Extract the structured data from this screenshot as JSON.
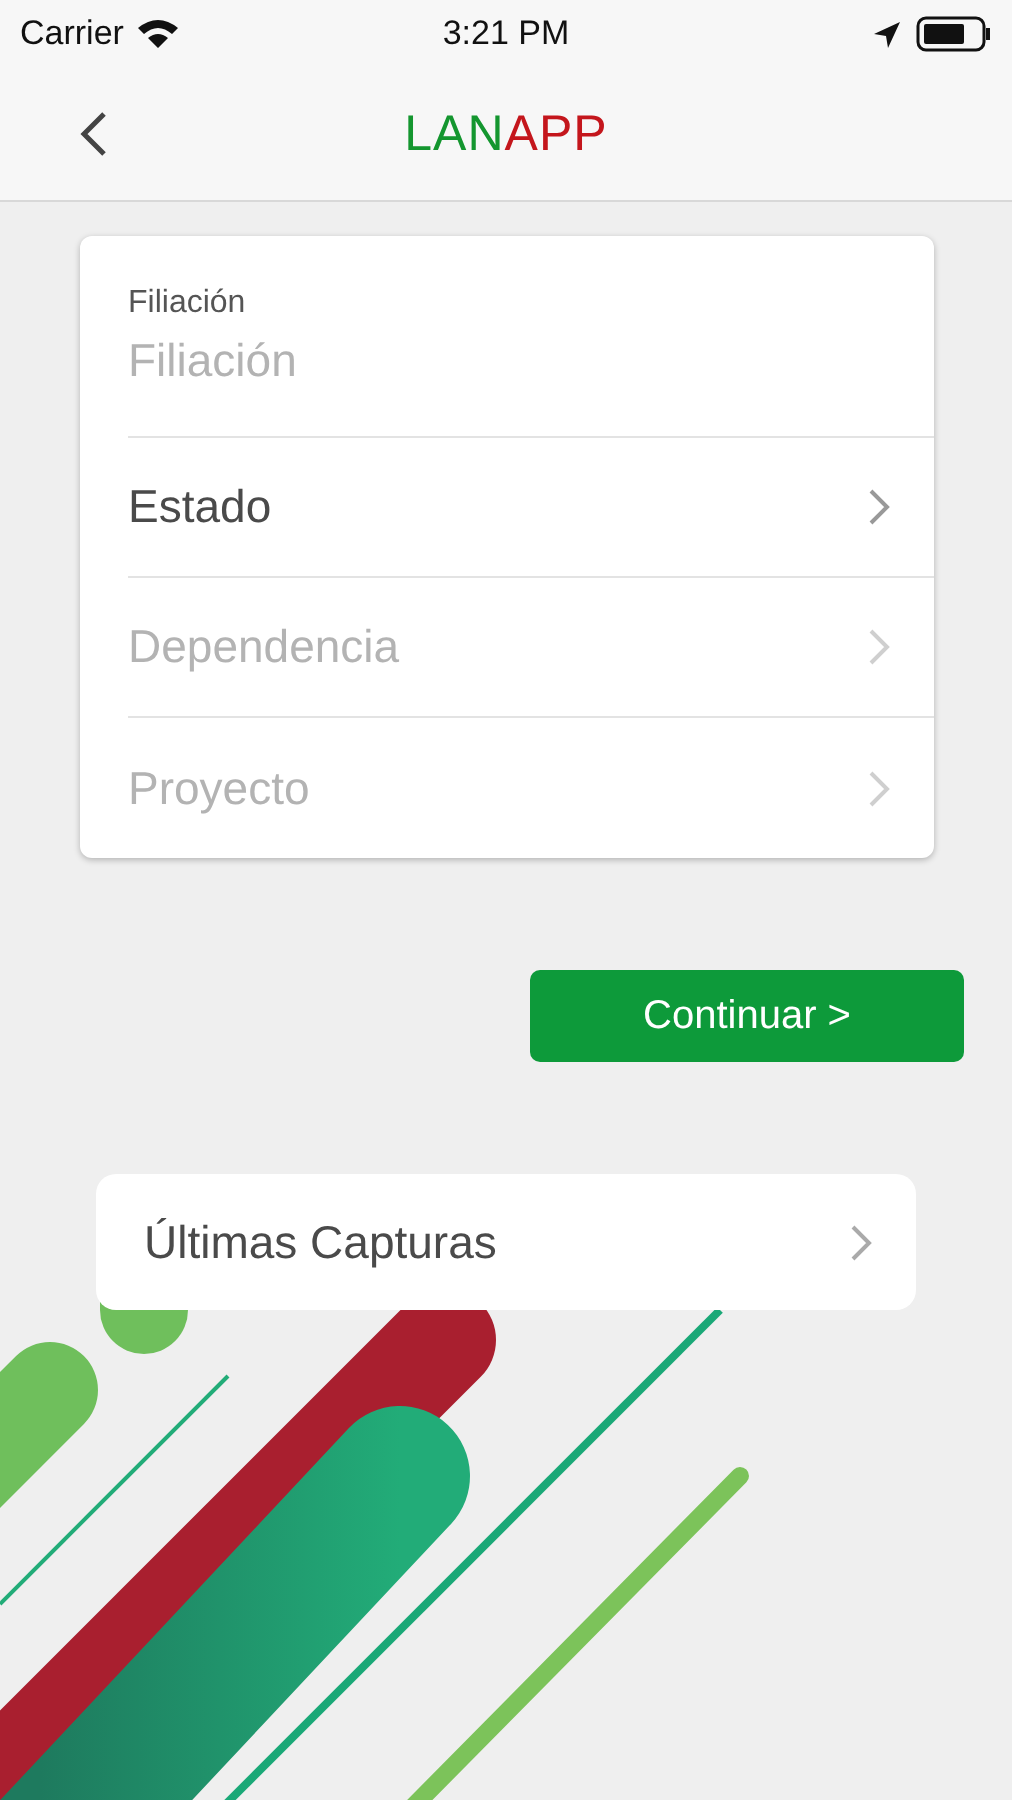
{
  "status_bar": {
    "carrier": "Carrier",
    "time": "3:21 PM"
  },
  "nav": {
    "logo": [
      {
        "text": "LAN",
        "color": "#14962f"
      },
      {
        "text": "APP",
        "color": "#c4161c"
      }
    ]
  },
  "form": {
    "field": {
      "label": "Filiación",
      "placeholder": "Filiación"
    },
    "selects": [
      {
        "label": "Estado",
        "disabled": false
      },
      {
        "label": "Dependencia",
        "disabled": true
      },
      {
        "label": "Proyecto",
        "disabled": true
      }
    ]
  },
  "continue_button": "Continuar >",
  "recent": {
    "label": "Últimas Capturas"
  }
}
